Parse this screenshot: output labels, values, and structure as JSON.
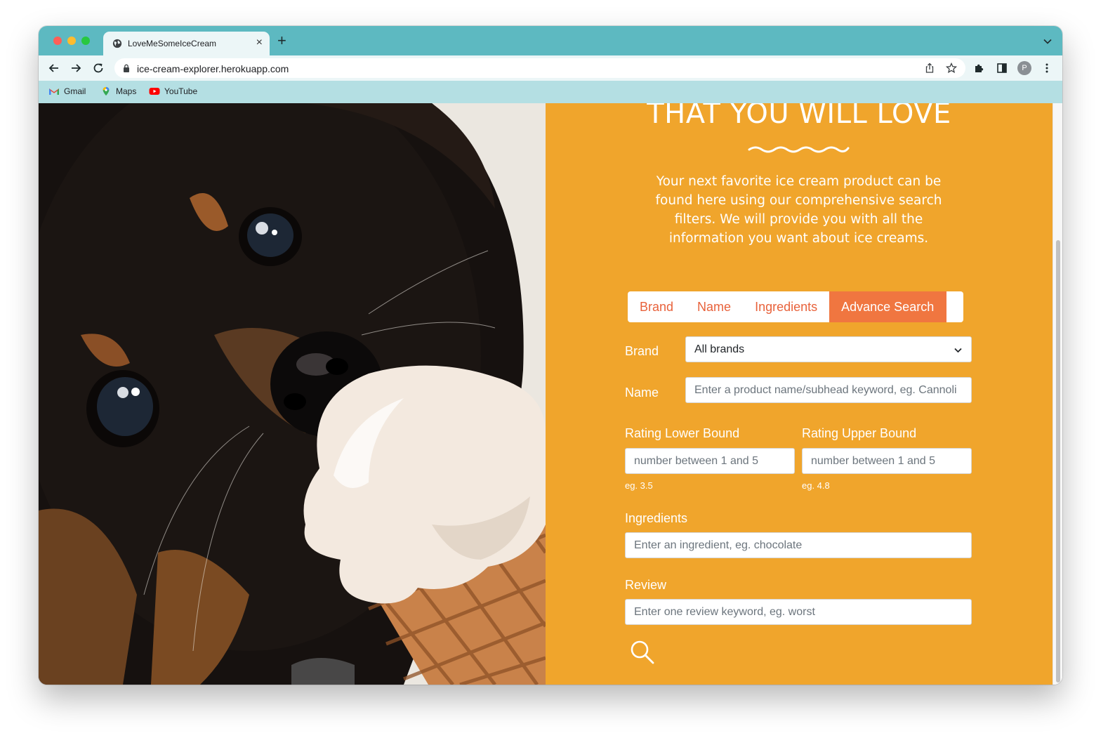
{
  "browser": {
    "tab_title": "LoveMeSomeIceCream",
    "tab_close": "×",
    "new_tab": "+",
    "url": "ice-cream-explorer.herokuapp.com",
    "avatar_letter": "P",
    "bookmarks": [
      {
        "label": "Gmail",
        "icon": "gmail-icon"
      },
      {
        "label": "Maps",
        "icon": "maps-icon"
      },
      {
        "label": "YouTube",
        "icon": "youtube-icon"
      }
    ],
    "colors": {
      "tabstrip": "#5db9c1",
      "toolbar": "#ecf6f7",
      "bookmarks_bar": "#b4dfe3"
    }
  },
  "hero": {
    "headline": "THAT YOU WILL LOVE",
    "intro": "Your next favorite ice cream product can be found here using our comprehensive search filters. We will provide you with all the information you want about ice creams."
  },
  "search_tabs": [
    {
      "label": "Brand",
      "active": false
    },
    {
      "label": "Name",
      "active": false
    },
    {
      "label": "Ingredients",
      "active": false
    },
    {
      "label": "Advance Search",
      "active": true
    }
  ],
  "form": {
    "brand_label": "Brand",
    "brand_value": "All brands",
    "name_label": "Name",
    "name_placeholder": "Enter a product name/subhead keyword, eg. Cannoli",
    "rating_lower_label": "Rating Lower Bound",
    "rating_lower_placeholder": "number between 1 and 5",
    "rating_lower_hint": "eg. 3.5",
    "rating_upper_label": "Rating Upper Bound",
    "rating_upper_placeholder": "number between 1 and 5",
    "rating_upper_hint": "eg. 4.8",
    "ingredients_label": "Ingredients",
    "ingredients_placeholder": "Enter an ingredient, eg. chocolate",
    "review_label": "Review",
    "review_placeholder": "Enter one review keyword, eg. worst"
  },
  "theme": {
    "panel": "#f0a52c",
    "accent": "#f07640",
    "tab_text": "#e8623b"
  }
}
